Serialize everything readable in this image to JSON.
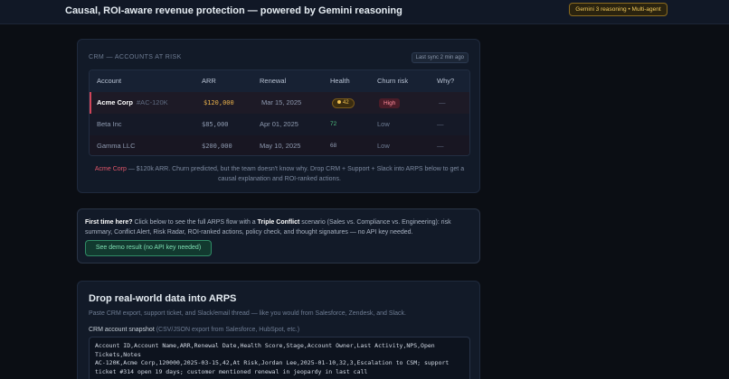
{
  "header": {
    "title": "Causal, ROI-aware revenue protection — powered by Gemini reasoning",
    "badge": "Gemini 3 reasoning • Multi-agent"
  },
  "crm": {
    "heading": "CRM — ACCOUNTS AT RISK",
    "sync_label": "Last sync 2 min ago",
    "columns": [
      "Account",
      "ARR",
      "Renewal",
      "Health",
      "Churn risk",
      "Why?"
    ],
    "rows": [
      {
        "account": "Acme Corp",
        "id": "#AC-120K",
        "arr": "$120,000",
        "renewal": "Mar 15, 2025",
        "health": "42",
        "churn": "High",
        "why": "—"
      },
      {
        "account": "Beta Inc",
        "id": "",
        "arr": "$85,000",
        "renewal": "Apr 01, 2025",
        "health": "72",
        "churn": "Low",
        "why": "—"
      },
      {
        "account": "Gamma LLC",
        "id": "",
        "arr": "$200,000",
        "renewal": "May 10, 2025",
        "health": "68",
        "churn": "Low",
        "why": "—"
      }
    ],
    "note_account": "Acme Corp",
    "note_text": " — $120k ARR. Churn predicted, but the team doesn't know why. Drop CRM + Support + Slack into ARPS below to get a causal explanation and ROI-ranked actions."
  },
  "demo": {
    "lead": "First time here?",
    "text1": " Click below to see the full ARPS flow with a ",
    "conflict": "Triple Conflict",
    "text2": " scenario (Sales vs. Compliance vs. Engineering): risk summary, Conflict Alert, Risk Radar, ROI-ranked actions, policy check, and thought signatures — no API key needed.",
    "button_label": "See demo result (no API key needed)"
  },
  "drop": {
    "title": "Drop real-world data into ARPS",
    "subtitle": "Paste CRM export, support ticket, and Slack/email thread — like you would from Salesforce, Zendesk, and Slack.",
    "crm_label": "CRM account snapshot",
    "crm_hint": " (CSV/JSON export from Salesforce, HubSpot, etc.)",
    "crm_value": "Account ID,Account Name,ARR,Renewal Date,Health Score,Stage,Account Owner,Last Activity,NPS,Open Tickets,Notes\nAC-120K,Acme Corp,120000,2025-03-15,42,At Risk,Jordan Lee,2025-01-10,32,3,Escalation to CSM; support ticket #314 open 19 days; customer mentioned renewal in jeopardy in last call"
  }
}
